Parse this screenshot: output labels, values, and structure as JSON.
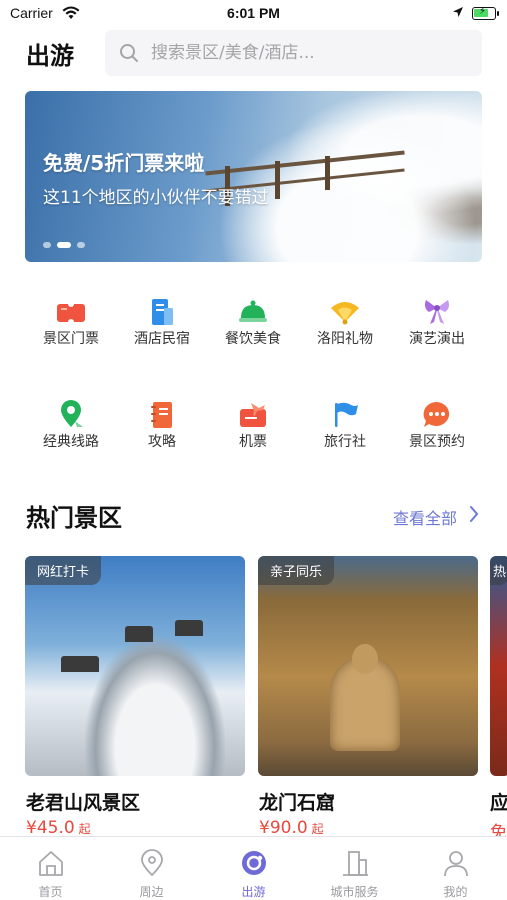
{
  "status_bar": {
    "carrier": "Carrier",
    "time": "6:01 PM"
  },
  "header": {
    "title": "出游",
    "search_placeholder": "搜索景区/美食/酒店..."
  },
  "banner": {
    "headline": "免费/5折门票来啦",
    "subline": "这11个地区的小伙伴不要错过",
    "slide_count": 3,
    "active_slide": 2
  },
  "categories": [
    {
      "label": "景区门票",
      "icon": "ticket-icon",
      "color": "#f0533e"
    },
    {
      "label": "酒店民宿",
      "icon": "hotel-icon",
      "color": "#2f8fe8"
    },
    {
      "label": "餐饮美食",
      "icon": "food-cloche-icon",
      "color": "#22b35a"
    },
    {
      "label": "洛阳礼物",
      "icon": "fan-icon",
      "color": "#f5b820"
    },
    {
      "label": "演艺演出",
      "icon": "bow-icon",
      "color": "#a96be0"
    },
    {
      "label": "经典线路",
      "icon": "route-pin-icon",
      "color": "#22b35a"
    },
    {
      "label": "攻略",
      "icon": "notebook-icon",
      "color": "#f0683a"
    },
    {
      "label": "机票",
      "icon": "plane-ticket-icon",
      "color": "#f0533e"
    },
    {
      "label": "旅行社",
      "icon": "flag-icon",
      "color": "#2f8fe8"
    },
    {
      "label": "景区预约",
      "icon": "chat-bubble-icon",
      "color": "#f0683a"
    }
  ],
  "hot_section": {
    "title": "热门景区",
    "view_all": "查看全部"
  },
  "cards": [
    {
      "tag": "网红打卡",
      "name": "老君山风景区",
      "price": "¥45.0",
      "unit": "起"
    },
    {
      "tag": "亲子同乐",
      "name": "龙门石窟",
      "price": "¥90.0",
      "unit": "起"
    },
    {
      "tag": "热",
      "name": "应",
      "price": "免"
    }
  ],
  "tabbar": [
    {
      "label": "首页",
      "icon": "home-icon"
    },
    {
      "label": "周边",
      "icon": "location-pin-icon"
    },
    {
      "label": "出游",
      "icon": "travel-circle-icon"
    },
    {
      "label": "城市服务",
      "icon": "city-buildings-icon"
    },
    {
      "label": "我的",
      "icon": "person-icon"
    }
  ],
  "colors": {
    "accent": "#6e6ad6",
    "price": "#e8483e",
    "view_all": "#6e79d6"
  }
}
